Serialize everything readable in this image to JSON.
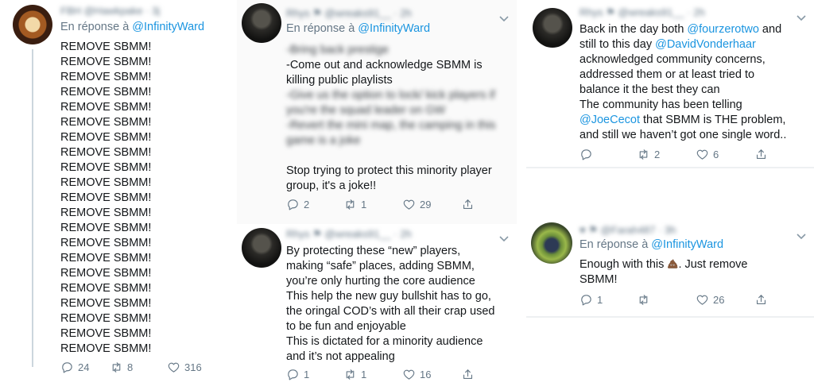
{
  "tweet1": {
    "header": "FBH @Hawkpake · 3j",
    "reply_prefix": "En réponse à ",
    "reply_mention": "@InfinityWard",
    "lines": [
      "REMOVE SBMM!",
      "REMOVE SBMM!",
      "REMOVE SBMM!",
      "REMOVE SBMM!",
      "REMOVE SBMM!",
      "REMOVE SBMM!",
      "REMOVE SBMM!",
      "REMOVE SBMM!",
      "REMOVE SBMM!",
      "REMOVE SBMM!",
      "REMOVE SBMM!",
      "REMOVE SBMM!",
      "REMOVE SBMM!",
      "REMOVE SBMM!",
      "REMOVE SBMM!",
      "REMOVE SBMM!",
      "REMOVE SBMM!",
      "REMOVE SBMM!",
      "REMOVE SBMM!",
      "REMOVE SBMM!",
      "REMOVE SBMM!"
    ],
    "replies": "24",
    "retweets": "8",
    "likes": "316"
  },
  "tweet2": {
    "header": "Rhys ⚑ @wreaks91__ · 2h",
    "reply_prefix": "En réponse à ",
    "reply_mention": "@InfinityWard",
    "blur1": "-Bring back prestige",
    "line1": "-Come out and acknowledge SBMM is",
    "line2": "killing public playlists",
    "blur2": "-Give us the option to lock/ kick players if",
    "blur3": "you're the squad leader on GW",
    "blur4": "-Revert the mini map, the camping in this",
    "blur5": "game is a joke",
    "line3": "Stop trying to protect this minority player",
    "line4": "group, it's a joke!!",
    "replies": "2",
    "retweets": "1",
    "likes": "29"
  },
  "tweet3": {
    "header": "Rhys ⚑ @wreaks91__ · 2h",
    "lines": [
      "By protecting these “new” players,",
      "making “safe” places, adding SBMM,",
      "you’re only hurting the core audience",
      "This help the new guy bullshit has to go,",
      "the oringal COD’s with all their crap used",
      "to be fun and enjoyable",
      "This is dictated for a minority audience",
      "and it’s not appealing"
    ],
    "replies": "1",
    "retweets": "1",
    "likes": "16"
  },
  "tweet4": {
    "header": "Rhys ⚑ @wreaks91__ · 2h",
    "l1a": "Back in the day both ",
    "l1m": "@fourzerotwo",
    "l1b": " and",
    "l2a": "still to this day ",
    "l2m": "@DavidVonderhaar",
    "l3": "acknowledged community concerns,",
    "l4": "addressed them or at least tried to",
    "l5": "balance it the best they can",
    "l6": "The community has been telling",
    "l7m": "@JoeCecot",
    "l7b": " that SBMM is THE problem,",
    "l8": "and still we haven’t got one single word..",
    "replies": "",
    "retweets": "2",
    "likes": "6"
  },
  "tweet5": {
    "header": "♥ ⚑ @Farah487 · 3h",
    "reply_prefix": "En réponse à ",
    "reply_mention": "@InfinityWard",
    "l1a": "Enough with this ",
    "l1b": ". Just remove",
    "l2": "SBMM!",
    "emoji": "pile-of-poo",
    "replies": "1",
    "retweets": "",
    "likes": "26"
  }
}
